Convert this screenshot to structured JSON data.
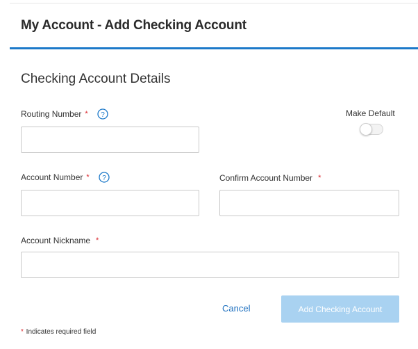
{
  "header": {
    "title": "My Account - Add Checking Account"
  },
  "section": {
    "title": "Checking Account Details"
  },
  "form": {
    "routing_number": {
      "label": "Routing Number",
      "required_mark": "*",
      "value": "",
      "placeholder": ""
    },
    "account_number": {
      "label": "Account Number",
      "required_mark": "*",
      "value": "",
      "placeholder": ""
    },
    "confirm_account_number": {
      "label": "Confirm Account Number",
      "required_mark": "*",
      "value": "",
      "placeholder": ""
    },
    "account_nickname": {
      "label": "Account Nickname",
      "required_mark": "*",
      "value": "",
      "placeholder": ""
    },
    "make_default": {
      "label": "Make Default",
      "on": false
    }
  },
  "actions": {
    "cancel_label": "Cancel",
    "submit_label": "Add Checking Account"
  },
  "footer": {
    "required_mark": "*",
    "note": " Indicates required field"
  },
  "colors": {
    "accent": "#1c79c9",
    "required": "#d9252b",
    "submit_disabled": "#a9d2f1",
    "link": "#1c6fbf"
  },
  "icons": {
    "help": "question-circle-icon"
  }
}
